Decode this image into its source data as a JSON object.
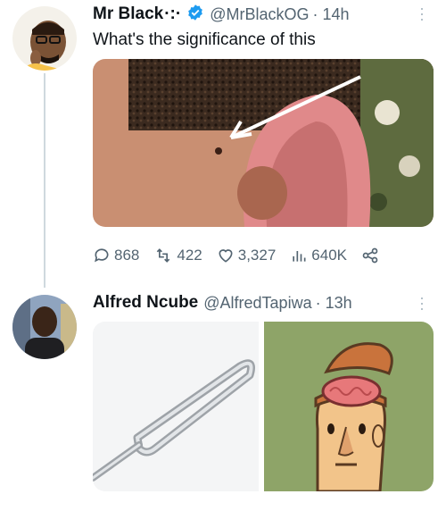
{
  "tweet1": {
    "display_name": "Mr Black",
    "name_suffix": "·:·",
    "handle": "@MrBlackOG",
    "time": "· 14h",
    "text": "What's the significance of this",
    "stats": {
      "replies": "868",
      "retweets": "422",
      "likes": "3,327",
      "views": "640K"
    }
  },
  "tweet2": {
    "display_name": "Alfred Ncube",
    "handle": "@AlfredTapiwa",
    "time": "· 13h"
  },
  "colors": {
    "verified": "#1d9bf0",
    "secondary": "#536471",
    "thread_line": "#cfd9de"
  },
  "icons": [
    "more-icon",
    "verified-badge-icon",
    "reply-icon",
    "retweet-icon",
    "like-icon",
    "views-icon",
    "share-icon"
  ]
}
